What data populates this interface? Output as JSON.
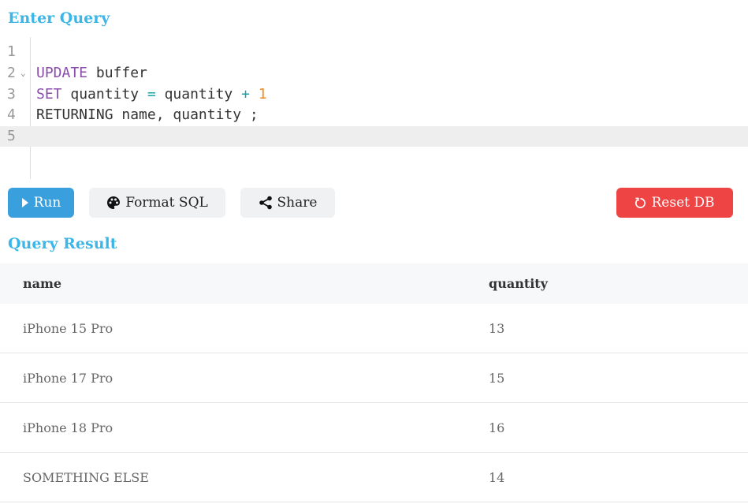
{
  "titles": {
    "query": "Enter Query",
    "result": "Query Result"
  },
  "editor": {
    "line_numbers": [
      "1",
      "2",
      "3",
      "4",
      "5"
    ],
    "fold_marker": "⌄",
    "code": {
      "l2_kw": "UPDATE",
      "l2_rest": " buffer",
      "l3_kw": "SET",
      "l3_a": " quantity ",
      "l3_eq": "=",
      "l3_b": " quantity ",
      "l3_plus": "+",
      "l3_sp": " ",
      "l3_num": "1",
      "l4": "RETURNING name, quantity ;"
    },
    "active_line": 5
  },
  "toolbar": {
    "run_label": "Run",
    "format_label": "Format SQL",
    "share_label": "Share",
    "reset_label": "Reset DB"
  },
  "result": {
    "columns": [
      "name",
      "quantity"
    ],
    "rows": [
      [
        "iPhone 15 Pro",
        "13"
      ],
      [
        "iPhone 17 Pro",
        "15"
      ],
      [
        "iPhone 18 Pro",
        "16"
      ],
      [
        "SOMETHING ELSE",
        "14"
      ]
    ]
  },
  "colors": {
    "title": "#3bb6e6",
    "run": "#3aa0dd",
    "reset": "#ee4444",
    "keyword": "#8a4dab",
    "operator": "#1aa3a3",
    "number": "#f28c28"
  }
}
